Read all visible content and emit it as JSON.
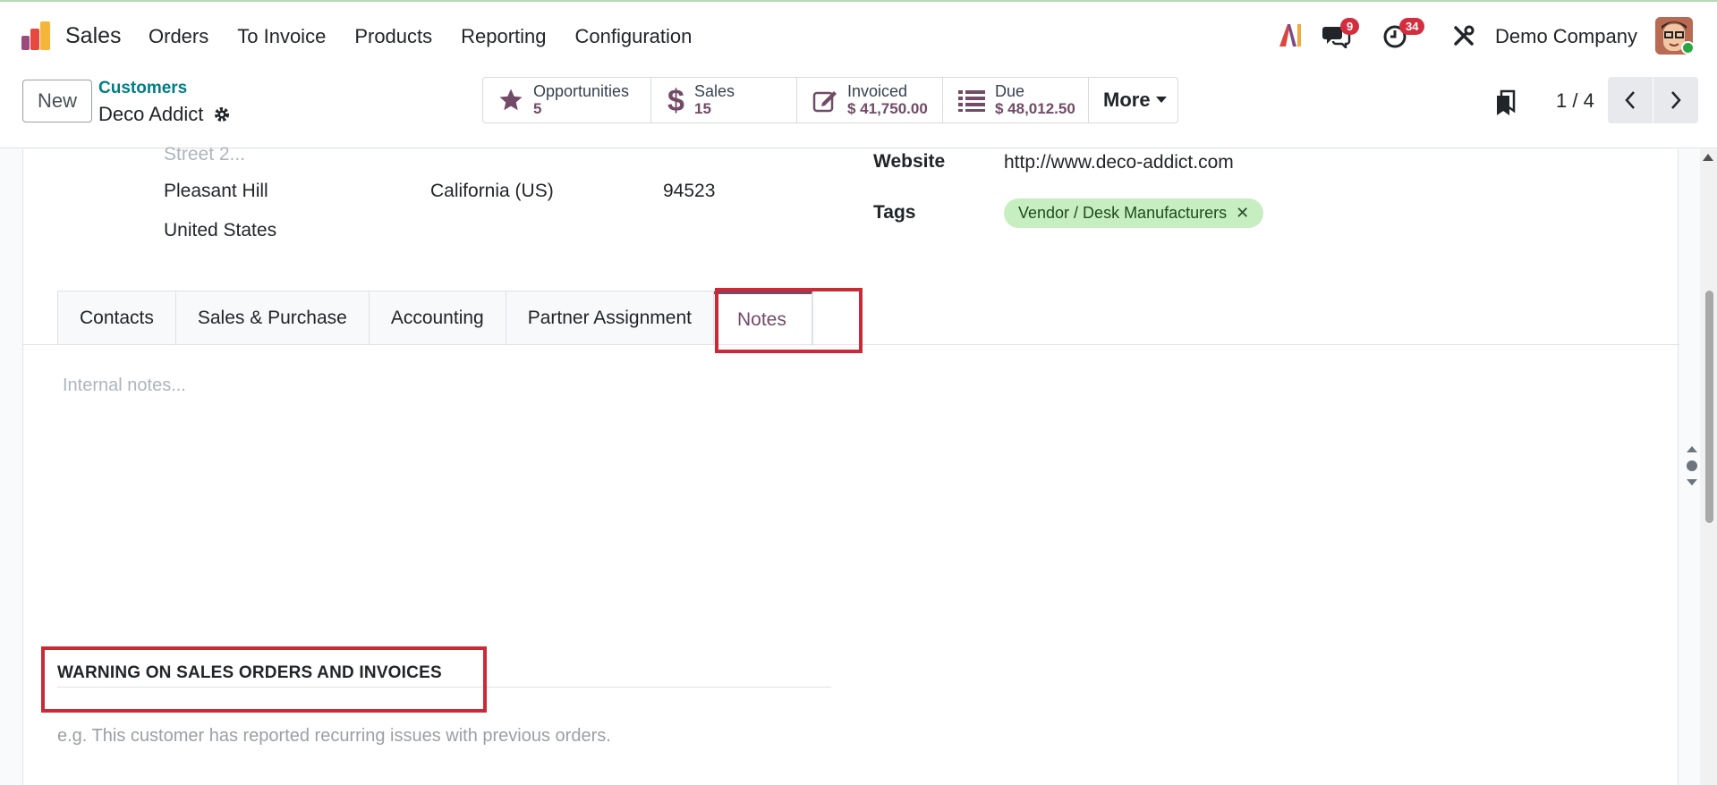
{
  "app": {
    "name": "Sales"
  },
  "menu": [
    "Orders",
    "To Invoice",
    "Products",
    "Reporting",
    "Configuration"
  ],
  "systray": {
    "messages_count": "9",
    "activities_count": "34",
    "company": "Demo Company"
  },
  "control": {
    "new_label": "New",
    "breadcrumb": "Customers",
    "record_name": "Deco Addict",
    "smart_buttons": [
      {
        "label": "Opportunities",
        "value": "5",
        "icon": "star-icon"
      },
      {
        "label": "Sales",
        "value": "15",
        "icon": "dollar-icon"
      },
      {
        "label": "Invoiced",
        "value": "$ 41,750.00",
        "icon": "edit-icon"
      },
      {
        "label": "Due",
        "value": "$ 48,012.50",
        "icon": "list-icon"
      }
    ],
    "more_label": "More",
    "pager": "1 / 4"
  },
  "address": {
    "street2_placeholder": "Street 2...",
    "city": "Pleasant Hill",
    "state": "California (US)",
    "zip": "94523",
    "country": "United States"
  },
  "fields": {
    "website_label": "Website",
    "website": "http://www.deco-addict.com",
    "tags_label": "Tags",
    "tag": "Vendor / Desk Manufacturers"
  },
  "tabs": [
    "Contacts",
    "Sales & Purchase",
    "Accounting",
    "Partner Assignment",
    "Notes"
  ],
  "notes": {
    "placeholder": "Internal notes...",
    "warning_title": "WARNING ON SALES ORDERS AND INVOICES",
    "warning_placeholder": "e.g. This customer has reported recurring issues with previous orders."
  },
  "colors": {
    "brand": "#714b67",
    "link": "#017e84",
    "highlight": "#cc2936",
    "tag_bg": "#c7eec0",
    "badge": "#d42e3e"
  }
}
